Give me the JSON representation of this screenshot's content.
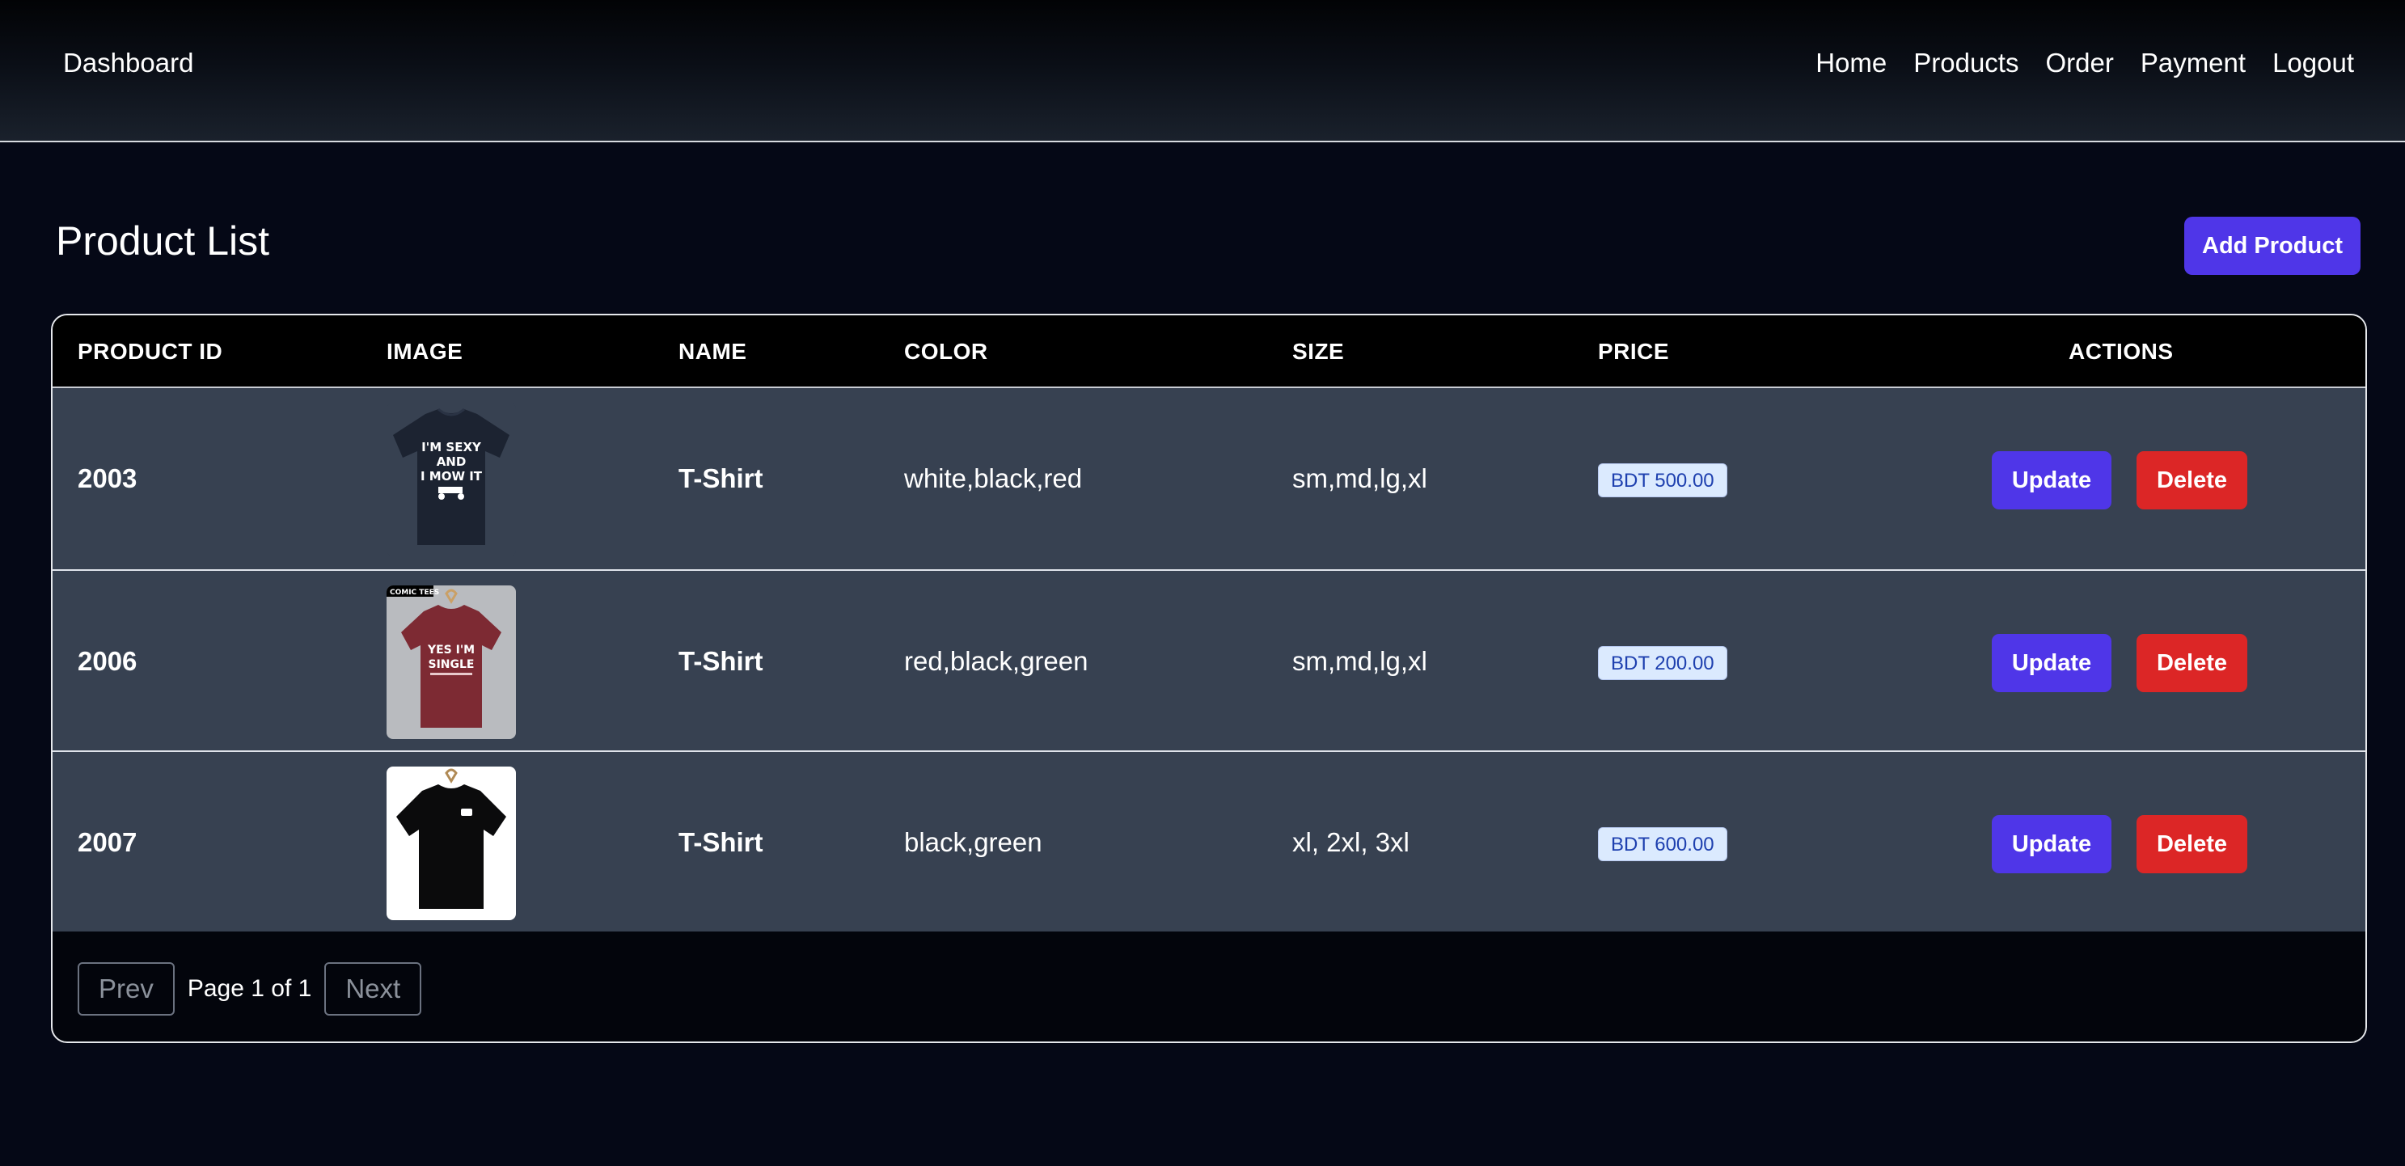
{
  "nav": {
    "brand": "Dashboard",
    "links": [
      "Home",
      "Products",
      "Order",
      "Payment",
      "Logout"
    ]
  },
  "page": {
    "title": "Product List",
    "add_button": "Add Product"
  },
  "table": {
    "headers": [
      "PRODUCT ID",
      "IMAGE",
      "NAME",
      "COLOR",
      "SIZE",
      "PRICE",
      "ACTIONS"
    ],
    "rows": [
      {
        "id": "2003",
        "name": "T-Shirt",
        "color": "white,black,red",
        "size": "sm,md,lg,xl",
        "price": "BDT 500.00",
        "image_text": "I'M SEXY AND I MOW IT",
        "image_icon": "navy-tshirt-image"
      },
      {
        "id": "2006",
        "name": "T-Shirt",
        "color": "red,black,green",
        "size": "sm,md,lg,xl",
        "price": "BDT 200.00",
        "image_text": "YES I'M SINGLE",
        "image_icon": "maroon-tshirt-image"
      },
      {
        "id": "2007",
        "name": "T-Shirt",
        "color": "black,green",
        "size": "xl, 2xl, 3xl",
        "price": "BDT 600.00",
        "image_text": "",
        "image_icon": "black-tshirt-image"
      }
    ],
    "update_label": "Update",
    "delete_label": "Delete"
  },
  "pagination": {
    "prev": "Prev",
    "info": "Page 1 of 1",
    "next": "Next"
  },
  "colors": {
    "background": "#050816",
    "row_bg": "#374151",
    "primary": "#4f36e8",
    "danger": "#dc2626",
    "badge_bg": "#dbeafe",
    "badge_text": "#1e40af"
  }
}
